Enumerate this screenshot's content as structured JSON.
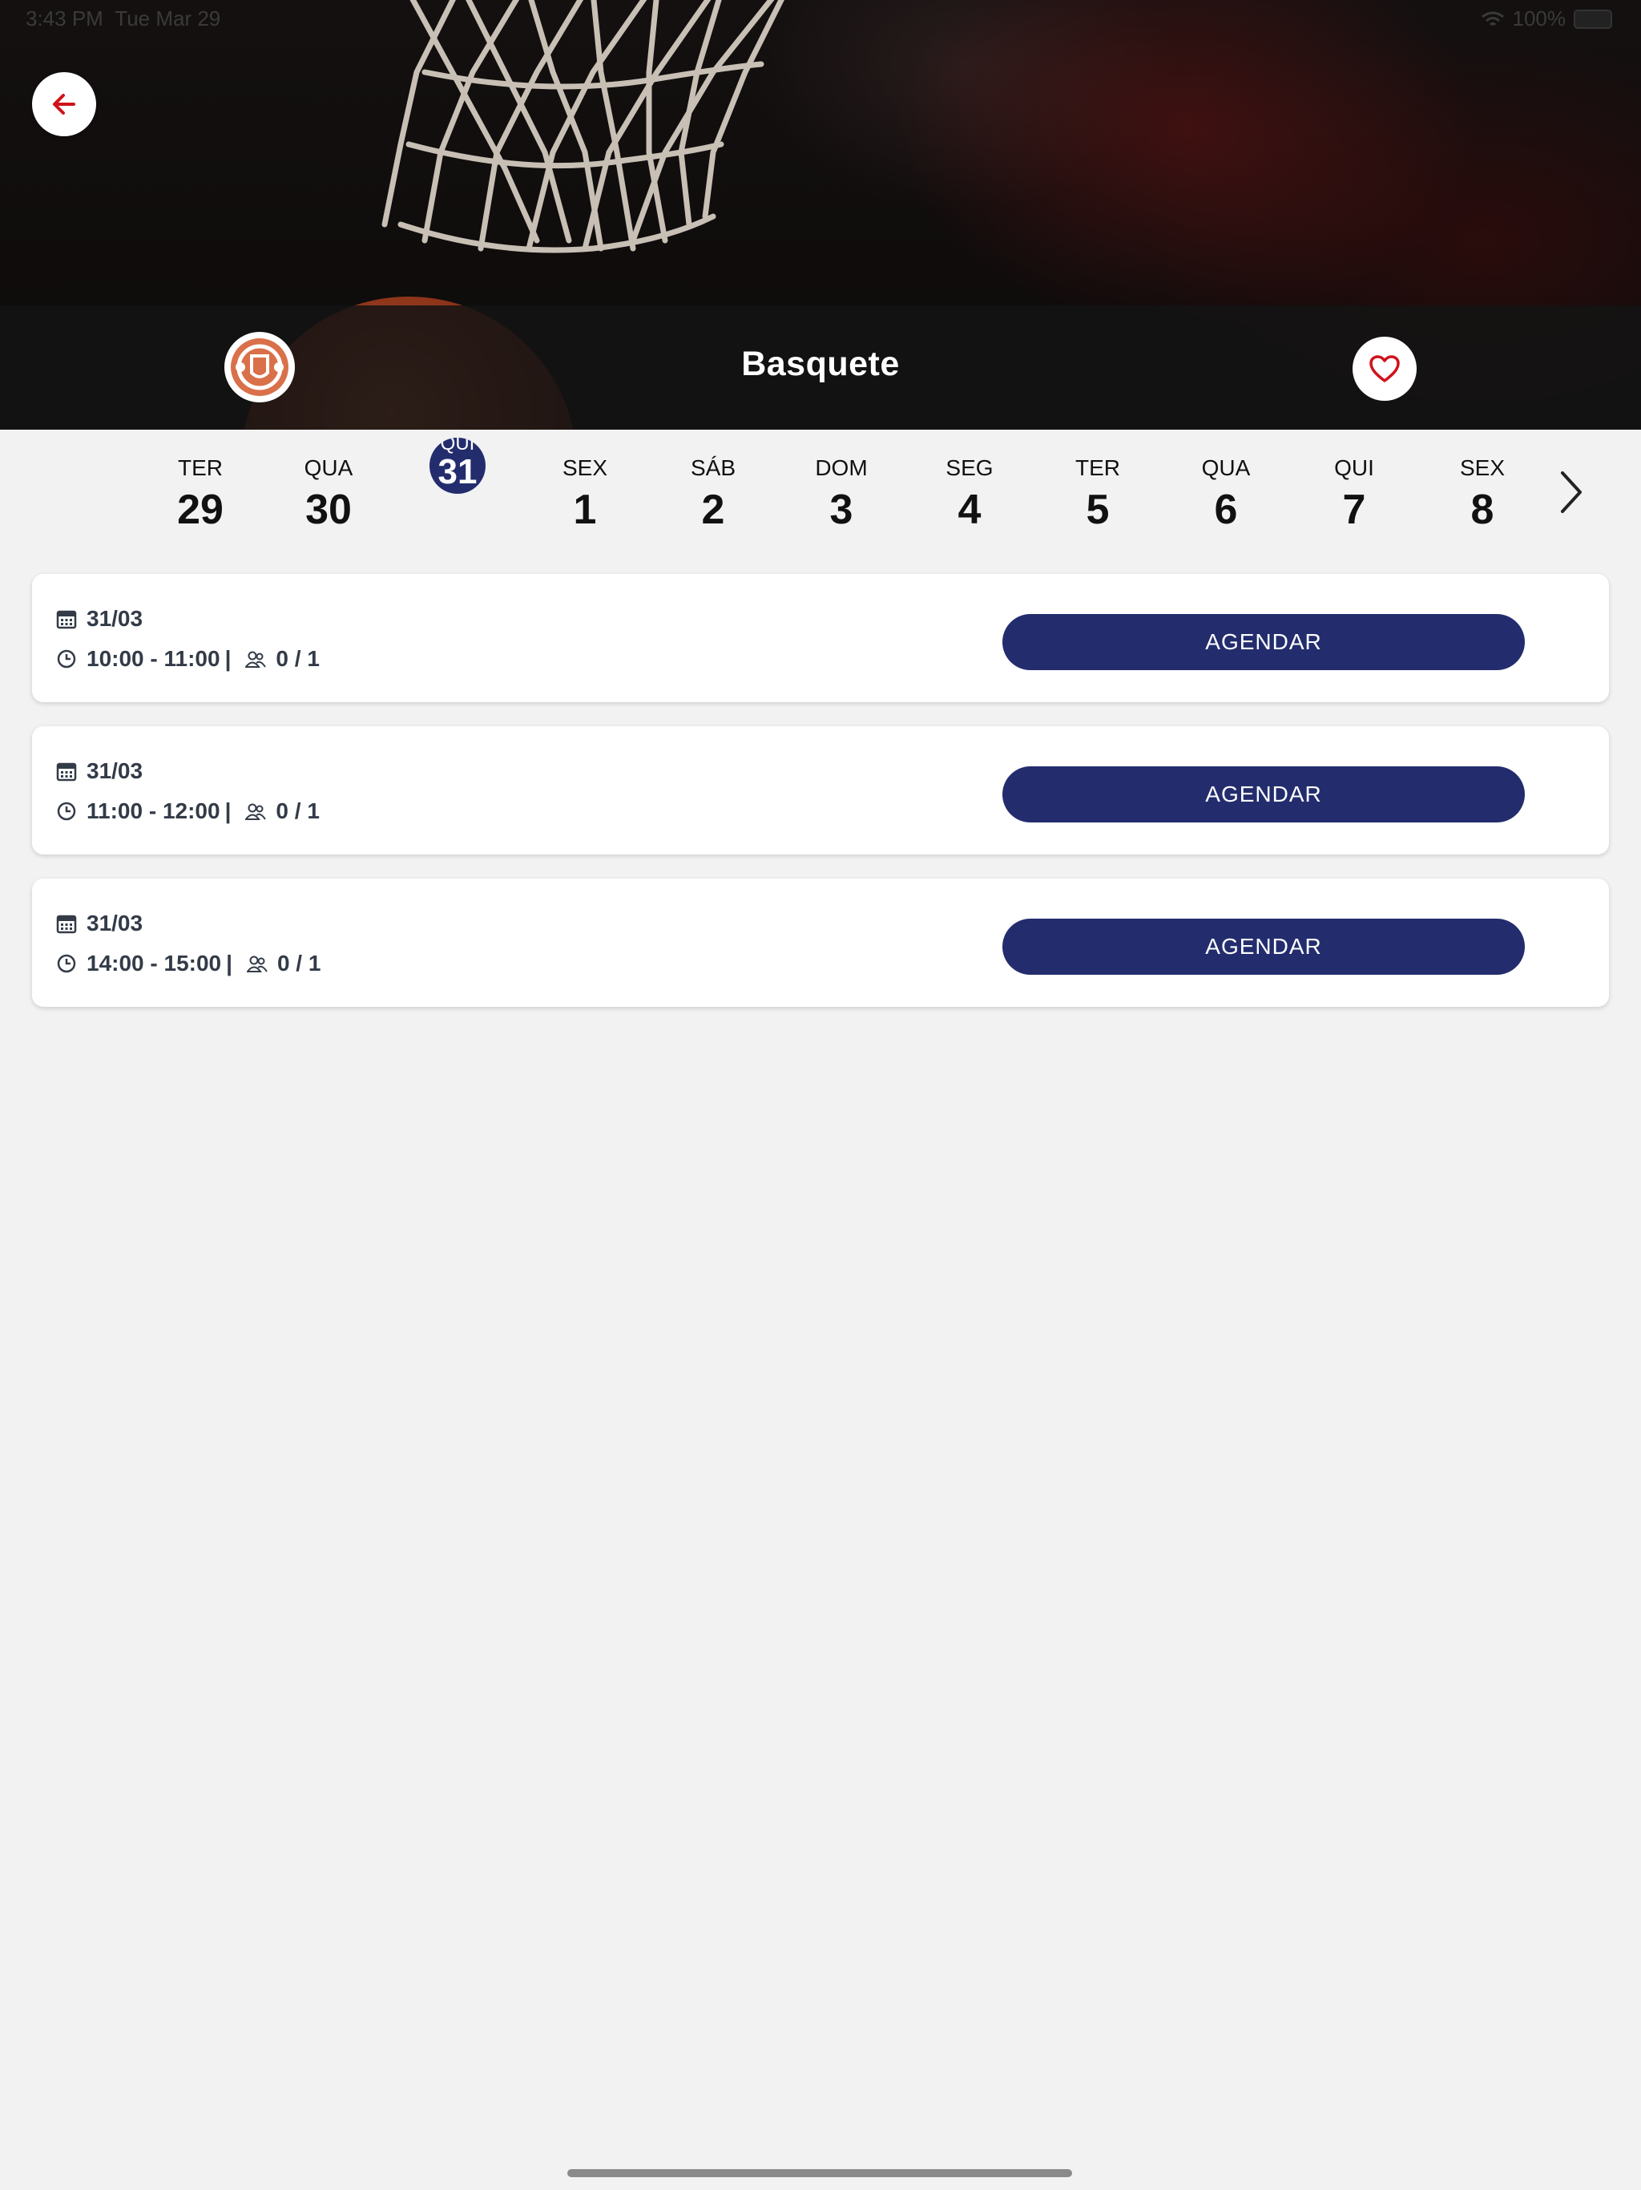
{
  "status_bar": {
    "time": "3:43 PM",
    "date": "Tue Mar 29",
    "battery": "100%"
  },
  "header": {
    "title": "Basquete"
  },
  "date_strip": {
    "days": [
      {
        "dow": "TER",
        "num": "29"
      },
      {
        "dow": "QUA",
        "num": "30"
      },
      {
        "dow": "QUI",
        "num": "31",
        "selected": true
      },
      {
        "dow": "SEX",
        "num": "1"
      },
      {
        "dow": "SÁB",
        "num": "2"
      },
      {
        "dow": "DOM",
        "num": "3"
      },
      {
        "dow": "SEG",
        "num": "4"
      },
      {
        "dow": "TER",
        "num": "5"
      },
      {
        "dow": "QUA",
        "num": "6"
      },
      {
        "dow": "QUI",
        "num": "7"
      },
      {
        "dow": "SEX",
        "num": "8"
      }
    ]
  },
  "slots": [
    {
      "date": "31/03",
      "time": "10:00 - 11:00",
      "capacity": "0 / 1",
      "button": "AGENDAR"
    },
    {
      "date": "31/03",
      "time": "11:00 - 12:00",
      "capacity": "0 / 1",
      "button": "AGENDAR"
    },
    {
      "date": "31/03",
      "time": "14:00 - 15:00",
      "capacity": "0 / 1",
      "button": "AGENDAR"
    }
  ],
  "separator": "|",
  "colors": {
    "primary": "#232d6e",
    "accent_red": "#d0121b",
    "logo_orange": "#d9704a"
  },
  "icons": {
    "back": "arrow-left-icon",
    "favorite": "heart-icon",
    "logo": "sport-logo-icon",
    "next": "chevron-right-icon",
    "calendar": "calendar-icon",
    "clock": "clock-icon",
    "people": "people-icon"
  }
}
